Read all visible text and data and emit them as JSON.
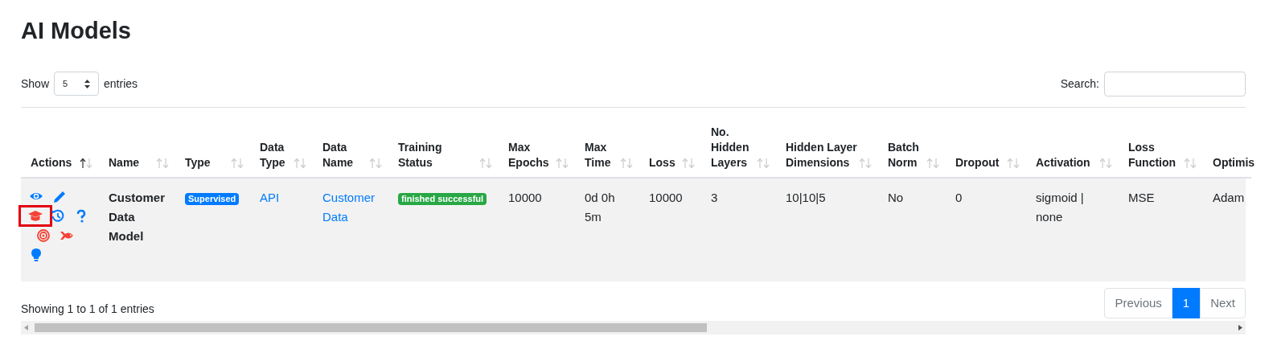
{
  "title": "AI Models",
  "length_menu": {
    "before": "Show",
    "value": "5",
    "after": "entries"
  },
  "search": {
    "label": "Search:"
  },
  "table": {
    "columns": [
      {
        "label": "Actions",
        "sorted_ascending": true
      },
      {
        "label": "Name",
        "sorted_ascending": false
      },
      {
        "label": "Type",
        "sorted_ascending": false
      },
      {
        "label": "Data Type",
        "sorted_ascending": false
      },
      {
        "label": "Data Name",
        "sorted_ascending": false
      },
      {
        "label": "Training Status",
        "sorted_ascending": false
      },
      {
        "label": "Max Epochs",
        "sorted_ascending": false
      },
      {
        "label": "Max Time",
        "sorted_ascending": false
      },
      {
        "label": "Loss",
        "sorted_ascending": false
      },
      {
        "label": "No. Hidden Layers",
        "sorted_ascending": false
      },
      {
        "label": "Hidden Layer Dimensions",
        "sorted_ascending": false
      },
      {
        "label": "Batch Norm",
        "sorted_ascending": false
      },
      {
        "label": "Dropout",
        "sorted_ascending": false
      },
      {
        "label": "Activation",
        "sorted_ascending": false
      },
      {
        "label": "Loss Function",
        "sorted_ascending": false
      },
      {
        "label": "Optimis"
      }
    ],
    "rows": [
      {
        "cells": [
          {
            "kind": "actions",
            "actions": [
              {
                "color": "#007bff",
                "highlighted": false
              },
              {
                "color": "#007bff",
                "highlighted": false
              },
              {
                "color": "#f44336",
                "highlighted": true
              },
              {
                "color": "#007bff",
                "highlighted": false
              },
              {
                "color": "#007bff",
                "highlighted": false
              },
              {
                "color": "#f44336",
                "highlighted": false
              },
              {
                "color": "#f44336",
                "highlighted": false
              },
              {
                "color": "#007bff",
                "highlighted": false
              }
            ]
          },
          {
            "kind": "bold",
            "text": "Customer Data Model"
          },
          {
            "kind": "badge",
            "text": "Supervised",
            "color": "#007bff"
          },
          {
            "kind": "link",
            "text": "API"
          },
          {
            "kind": "link",
            "text": "Customer Data"
          },
          {
            "kind": "badge",
            "text": "finished successful",
            "color": "#28a745"
          },
          {
            "kind": "text",
            "text": "10000"
          },
          {
            "kind": "text",
            "text": "0d 0h 5m"
          },
          {
            "kind": "text",
            "text": "10000"
          },
          {
            "kind": "text",
            "text": "3"
          },
          {
            "kind": "text",
            "text": "10|10|5"
          },
          {
            "kind": "text",
            "text": "No"
          },
          {
            "kind": "text",
            "text": "0"
          },
          {
            "kind": "text",
            "text": "sigmoid | none"
          },
          {
            "kind": "text",
            "text": "MSE"
          },
          {
            "kind": "text",
            "text": "Adam"
          }
        ]
      }
    ]
  },
  "info": "Showing 1 to 1 of 1 entries",
  "pagination": [
    {
      "label": "Previous",
      "selected": false
    },
    {
      "label": "1",
      "selected": true
    },
    {
      "label": "Next",
      "selected": false
    }
  ]
}
